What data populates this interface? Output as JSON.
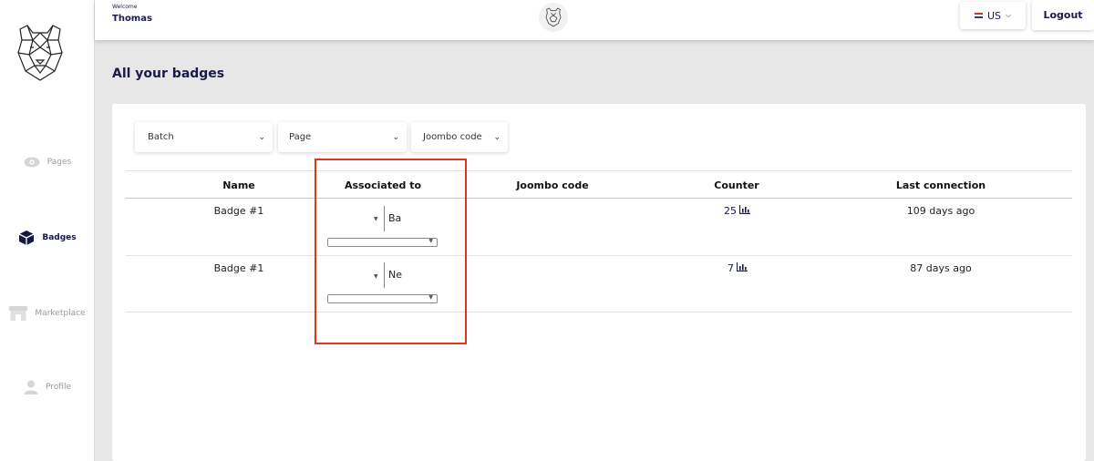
{
  "sidebar": {
    "items": [
      {
        "label": "Pages"
      },
      {
        "label": "Badges"
      },
      {
        "label": "Marketplace"
      },
      {
        "label": "Profile"
      }
    ]
  },
  "header": {
    "welcome": "Welcome",
    "user": "Thomas",
    "language": "US",
    "logout": "Logout"
  },
  "main": {
    "title": "All your badges",
    "filters": [
      {
        "label": "Batch"
      },
      {
        "label": "Page"
      },
      {
        "label": "Joombo code"
      }
    ],
    "table": {
      "columns": [
        "Name",
        "Associated to",
        "Joombo code",
        "Counter",
        "Last connection"
      ],
      "rows": [
        {
          "name": "Badge #1",
          "associated": "Ba",
          "joombo_code": "",
          "counter": "25",
          "last_connection": "109 days ago"
        },
        {
          "name": "Badge #1",
          "associated": "Ne",
          "joombo_code": "",
          "counter": "7",
          "last_connection": "87 days ago"
        }
      ]
    }
  },
  "colors": {
    "accent": "#1b1b4a",
    "highlight": "#e0341f",
    "background": "#e7e7e7"
  }
}
